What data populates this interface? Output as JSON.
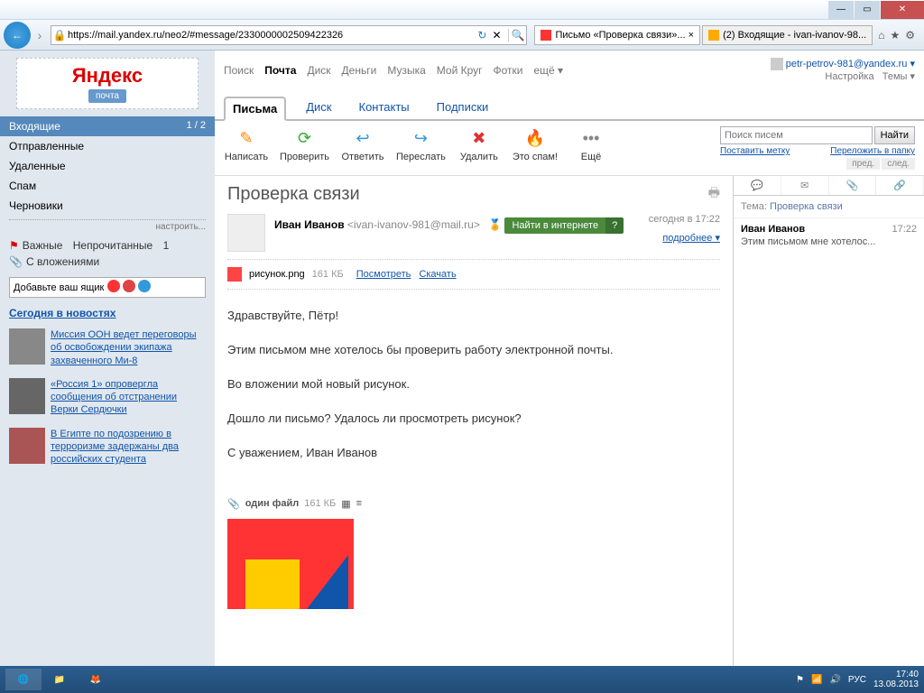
{
  "browser": {
    "url": "https://mail.yandex.ru/neo2/#message/2330000002509422326",
    "tabs": [
      {
        "label": "Письмо «Проверка связи»... ×"
      },
      {
        "label": "(2) Входящие - ivan-ivanov-98..."
      }
    ]
  },
  "logo": {
    "brand": "Яндекс",
    "product": "почта"
  },
  "folders": {
    "inbox": "Входящие",
    "inbox_count": "1 / 2",
    "sent": "Отправленные",
    "trash": "Удаленные",
    "spam": "Спам",
    "drafts": "Черновики",
    "configure": "настроить..."
  },
  "labels": {
    "important": "Важные",
    "unread": "Непрочитанные",
    "unread_count": "1",
    "attachments": "С вложениями",
    "add_box": "Добавьте ваш ящик"
  },
  "news": {
    "header": "Сегодня в новостях",
    "items": [
      "Миссия ООН ведет переговоры об освобождении экипажа захваченного Ми-8",
      "«Россия 1» опровергла сообщения об отстранении Верки Сердючки",
      "В Египте по подозрению в терроризме задержаны два российских студента"
    ]
  },
  "services": {
    "search": "Поиск",
    "mail": "Почта",
    "disk": "Диск",
    "money": "Деньги",
    "music": "Музыка",
    "circle": "Мой Круг",
    "photos": "Фотки",
    "more": "ещё ▾"
  },
  "user": {
    "email": "petr-petrov-981@yandex.ru ▾",
    "settings": "Настройка",
    "themes": "Темы ▾"
  },
  "section_tabs": {
    "letters": "Письма",
    "disk": "Диск",
    "contacts": "Контакты",
    "subs": "Подписки"
  },
  "toolbar": {
    "compose": "Написать",
    "check": "Проверить",
    "reply": "Ответить",
    "forward": "Переслать",
    "delete": "Удалить",
    "spam": "Это спам!",
    "more": "Ещё"
  },
  "search": {
    "placeholder": "Поиск писем",
    "button": "Найти",
    "set_label": "Поставить метку",
    "move_to": "Переложить в папку",
    "prev": "пред.",
    "next": "след."
  },
  "message": {
    "subject": "Проверка связи",
    "from_name": "Иван Иванов",
    "from_email": "<ivan-ivanov-981@mail.ru>",
    "date": "сегодня в 17:22",
    "details": "подробнее ▾",
    "find_internet": "Найти в интернете",
    "attachment": {
      "name": "рисунок.png",
      "size": "161 КБ",
      "view": "Посмотреть",
      "download": "Скачать"
    },
    "body": [
      "Здравствуйте, Пётр!",
      "Этим письмом мне хотелось бы проверить работу электронной почты.",
      "Во вложении мой новый рисунок.",
      "Дошло ли письмо? Удалось ли просмотреть рисунок?",
      "С уважением, Иван Иванов"
    ],
    "files_summary": "один файл",
    "files_size": "161 КБ"
  },
  "preview": {
    "theme_label": "Тема:",
    "theme_value": "Проверка связи",
    "from": "Иван Иванов",
    "time": "17:22",
    "excerpt": "Этим письмом мне хотелос..."
  },
  "taskbar": {
    "lang": "РУС",
    "time": "17:40",
    "date": "13.08.2013"
  }
}
